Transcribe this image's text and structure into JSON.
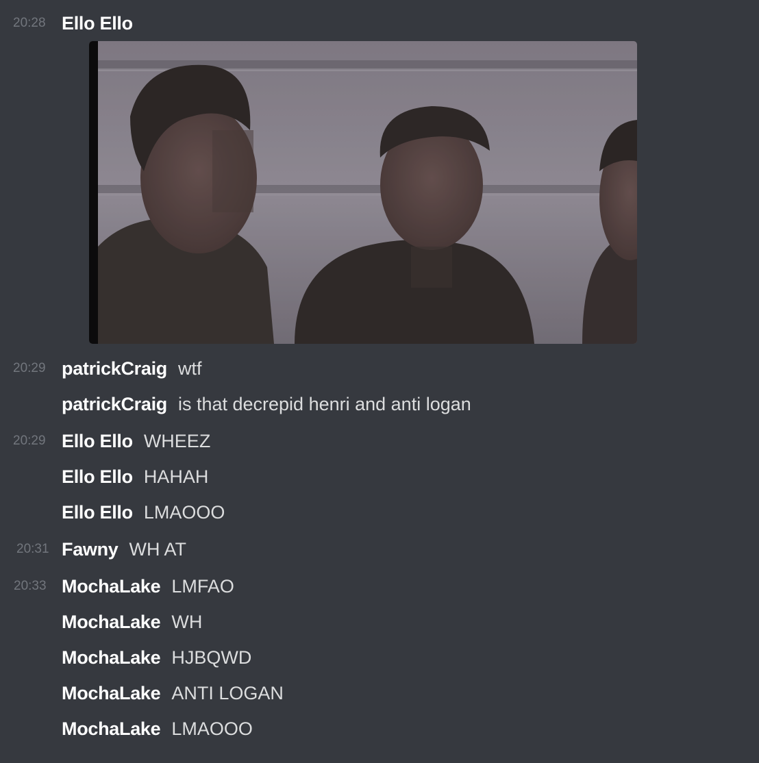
{
  "messages": [
    {
      "timestamp": "20:28",
      "author": "Ello Ello",
      "text": ""
    },
    {
      "timestamp": "20:29",
      "author": "patrickCraig",
      "text": "wtf"
    },
    {
      "timestamp": "",
      "author": "patrickCraig",
      "text": "is that decrepid henri and anti logan"
    },
    {
      "timestamp": "20:29",
      "author": "Ello Ello",
      "text": "WHEEZ"
    },
    {
      "timestamp": "",
      "author": "Ello Ello",
      "text": "HAHAH"
    },
    {
      "timestamp": "",
      "author": "Ello Ello",
      "text": "LMAOOO"
    },
    {
      "timestamp": "20:31",
      "author": "Fawny",
      "text": "WH AT"
    },
    {
      "timestamp": "20:33",
      "author": "MochaLake",
      "text": "LMFAO"
    },
    {
      "timestamp": "",
      "author": "MochaLake",
      "text": "WH"
    },
    {
      "timestamp": "",
      "author": "MochaLake",
      "text": "HJBQWD"
    },
    {
      "timestamp": "",
      "author": "MochaLake",
      "text": "ANTI LOGAN"
    },
    {
      "timestamp": "",
      "author": "MochaLake",
      "text": "LMAOOO"
    }
  ],
  "colors": {
    "background": "#36393f",
    "author": "#ffffff",
    "message_text": "#dcddde",
    "timestamp": "#72767d"
  },
  "attachment": {
    "type": "image",
    "description_icon": "photo-icon"
  }
}
